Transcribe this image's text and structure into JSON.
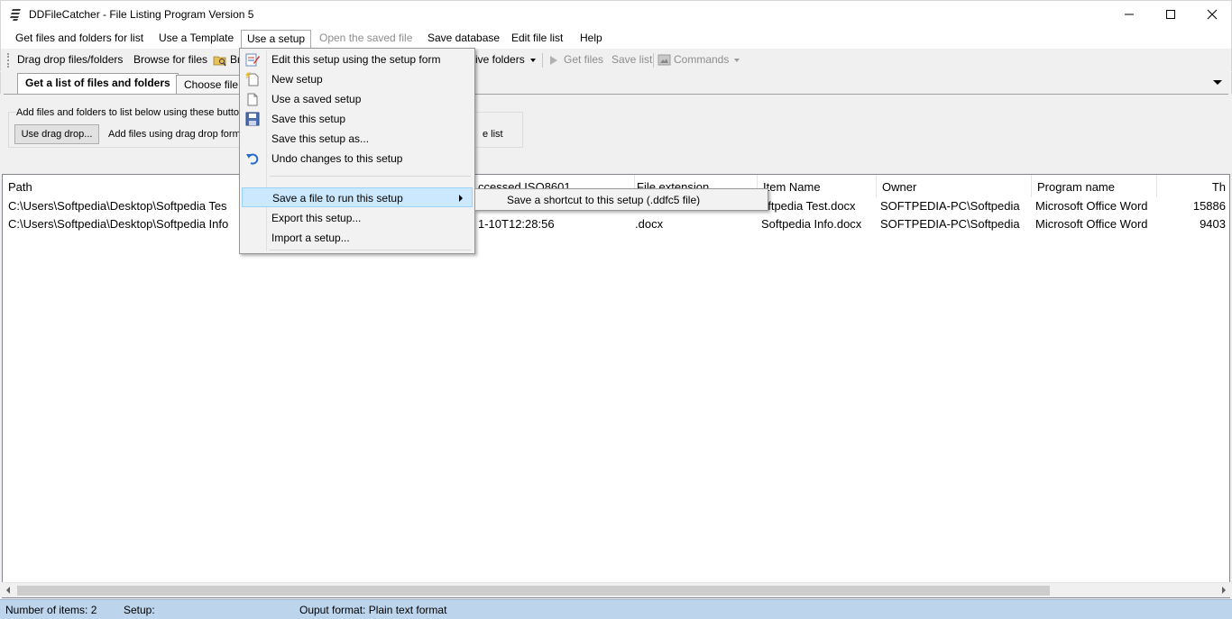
{
  "window": {
    "title": "DDFileCatcher - File Listing Program Version 5"
  },
  "menu": {
    "items": [
      {
        "label": "Get files and folders for list"
      },
      {
        "label": "Use a Template"
      },
      {
        "label": "Use a setup"
      },
      {
        "label": "Open the saved file"
      },
      {
        "label": "Save database"
      },
      {
        "label": "Edit file list"
      },
      {
        "label": "Help"
      }
    ]
  },
  "toolbar": {
    "drag_drop": "Drag drop files/folders",
    "browse_files": "Browse for files",
    "browse_frag": "Br",
    "drive_folders": "ive folders",
    "get_files": "Get files",
    "save_list": "Save list",
    "commands": "Commands"
  },
  "tabs": [
    {
      "label": "Get a list of files and folders"
    },
    {
      "label": "Choose file"
    }
  ],
  "panel": {
    "hint": "Add files and folders to list below using these buttons",
    "use_drag_drop": "Use drag drop...",
    "add_files_desc": "Add files using drag drop form",
    "right_fragment": "e list"
  },
  "list": {
    "columns": [
      "Path",
      "ccessed ISO8601",
      "File extension",
      "Item Name",
      "Owner",
      "Program name",
      "Th"
    ],
    "rows": [
      [
        "C:\\Users\\Softpedia\\Desktop\\Softpedia Tes",
        "",
        "",
        "oftpedia Test.docx",
        "SOFTPEDIA-PC\\Softpedia",
        "Microsoft Office Word",
        "15886"
      ],
      [
        "C:\\Users\\Softpedia\\Desktop\\Softpedia Info",
        "1-10T12:28:56",
        ".docx",
        "Softpedia Info.docx",
        "SOFTPEDIA-PC\\Softpedia",
        "Microsoft Office Word",
        "9403"
      ]
    ]
  },
  "dropdown": {
    "items": [
      {
        "label": "Edit this setup using the setup form",
        "icon": "edit-form-icon"
      },
      {
        "label": "New setup",
        "icon": "new-doc-icon"
      },
      {
        "label": "Use a saved setup",
        "icon": "open-doc-icon"
      },
      {
        "label": "Save this setup",
        "icon": "floppy-icon"
      },
      {
        "label": "Save this setup as..."
      },
      {
        "label": "Undo changes to this setup",
        "icon": "undo-icon"
      },
      {
        "label": "Save a file to run this setup"
      },
      {
        "label": "Export this setup..."
      },
      {
        "label": "Import a setup..."
      }
    ],
    "submenu": {
      "label": "Save a shortcut to this setup (.ddfc5 file)"
    }
  },
  "status": {
    "items_count": "Number of items: 2",
    "setup": "Setup:",
    "output_format": "Ouput format: Plain text format"
  },
  "colors": {
    "highlight": "#cce8ff",
    "statusbar": "#bcd4ec"
  }
}
